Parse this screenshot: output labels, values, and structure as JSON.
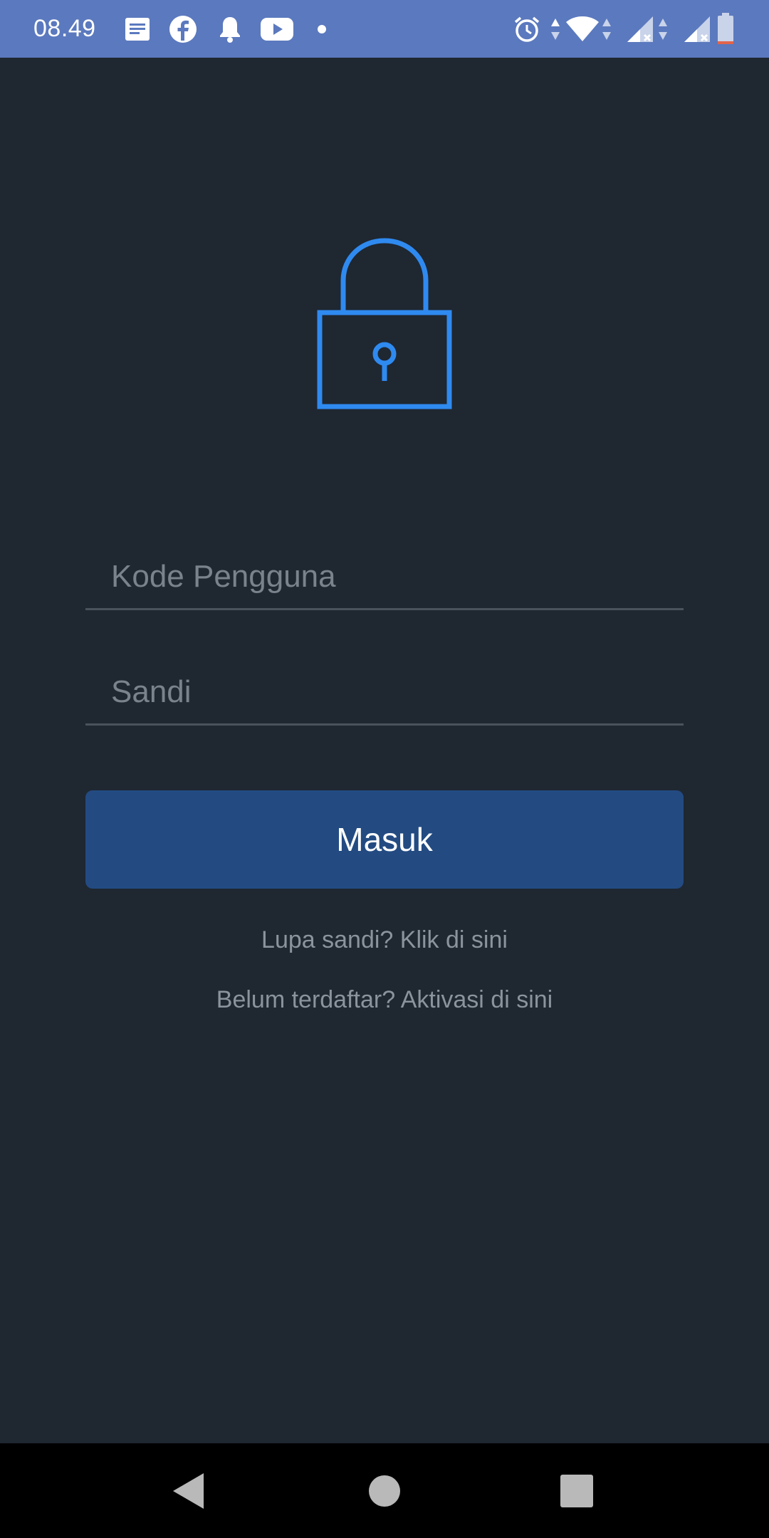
{
  "status_bar": {
    "time": "08.49",
    "left_icons": [
      "messages-icon",
      "facebook-icon",
      "notification-bell-icon",
      "youtube-icon",
      "dot-icon"
    ],
    "right_icons": [
      "alarm-icon",
      "wifi-icon",
      "signal-no-sim-icon",
      "signal-no-sim-icon",
      "battery-low-icon"
    ],
    "battery_level_fraction": 0.1,
    "battery_low_color": "#e2644a"
  },
  "login": {
    "icon": "lock-icon",
    "accent_color": "#2f8af0",
    "username_placeholder": "Kode Pengguna",
    "username_value": "",
    "password_placeholder": "Sandi",
    "password_value": "",
    "submit_label": "Masuk",
    "forgot_password_link": "Lupa sandi? Klik di sini",
    "register_link": "Belum terdaftar? Aktivasi di sini"
  },
  "nav_bar": {
    "items": [
      "back-icon",
      "home-icon",
      "recents-icon"
    ]
  }
}
